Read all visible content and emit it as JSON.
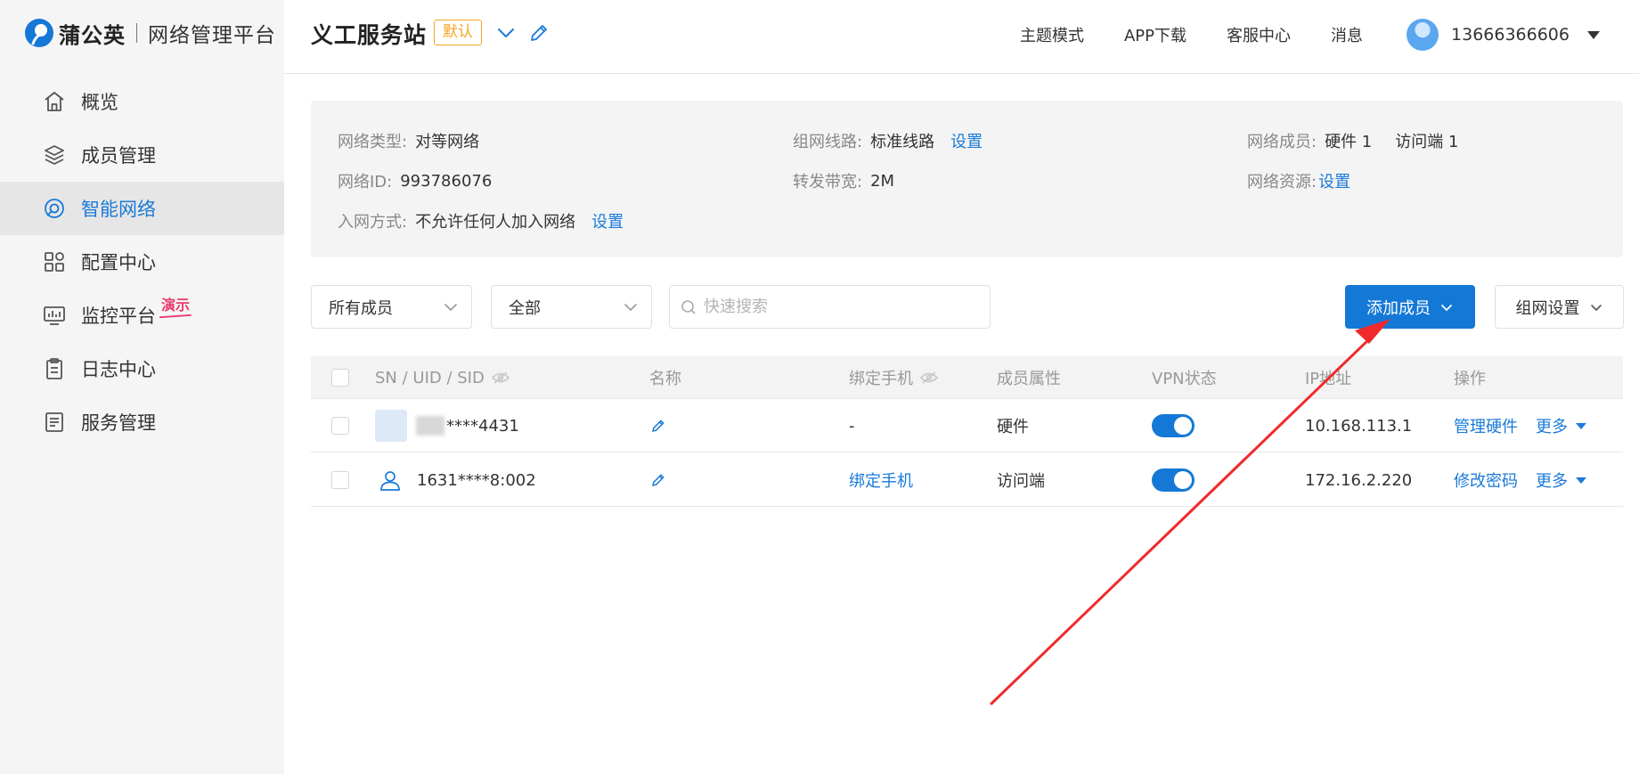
{
  "brand": {
    "name": "蒲公英",
    "subtitle": "网络管理平台"
  },
  "sidebar": {
    "items": [
      {
        "label": "概览",
        "icon": "home-icon"
      },
      {
        "label": "成员管理",
        "icon": "layers-icon"
      },
      {
        "label": "智能网络",
        "icon": "network-icon",
        "active": true
      },
      {
        "label": "配置中心",
        "icon": "grid-icon"
      },
      {
        "label": "监控平台",
        "icon": "monitor-icon",
        "badge": "演示"
      },
      {
        "label": "日志中心",
        "icon": "clipboard-icon"
      },
      {
        "label": "服务管理",
        "icon": "document-icon"
      }
    ]
  },
  "header": {
    "station": "义工服务站",
    "tag": "默认",
    "links": [
      "主题模式",
      "APP下载",
      "客服中心",
      "消息"
    ],
    "user_phone": "13666366606"
  },
  "info": {
    "network_type": {
      "label": "网络类型:",
      "value": "对等网络"
    },
    "network_id": {
      "label": "网络ID:",
      "value": "993786076"
    },
    "join_method": {
      "label": "入网方式:",
      "value": "不允许任何人加入网络",
      "action": "设置"
    },
    "route": {
      "label": "组网线路:",
      "value": "标准线路",
      "action": "设置"
    },
    "bandwidth": {
      "label": "转发带宽:",
      "value": "2M"
    },
    "members": {
      "label": "网络成员:",
      "hardware": "硬件 1",
      "clients": "访问端 1"
    },
    "resources": {
      "label": "网络资源:",
      "action": "设置"
    }
  },
  "toolbar": {
    "member_filter": "所有成员",
    "type_filter": "全部",
    "search_placeholder": "快速搜索",
    "add_member": "添加成员",
    "network_settings": "组网设置"
  },
  "table": {
    "columns": [
      "SN / UID / SID",
      "名称",
      "绑定手机",
      "成员属性",
      "VPN状态",
      "IP地址",
      "操作"
    ],
    "rows": [
      {
        "id": "****4431",
        "phone": "-",
        "attr": "硬件",
        "vpn_on": true,
        "ip": "10.168.113.1",
        "action": "管理硬件",
        "more": "更多"
      },
      {
        "id": "1631****8:002",
        "phone": "绑定手机",
        "attr": "访问端",
        "vpn_on": true,
        "ip": "172.16.2.220",
        "action": "修改密码",
        "more": "更多"
      }
    ]
  },
  "colors": {
    "primary": "#1478d6",
    "link": "#1a7ad8",
    "tag": "#f5a623",
    "badge": "#ea3b6f",
    "annotation_arrow": "#f02a2a"
  }
}
